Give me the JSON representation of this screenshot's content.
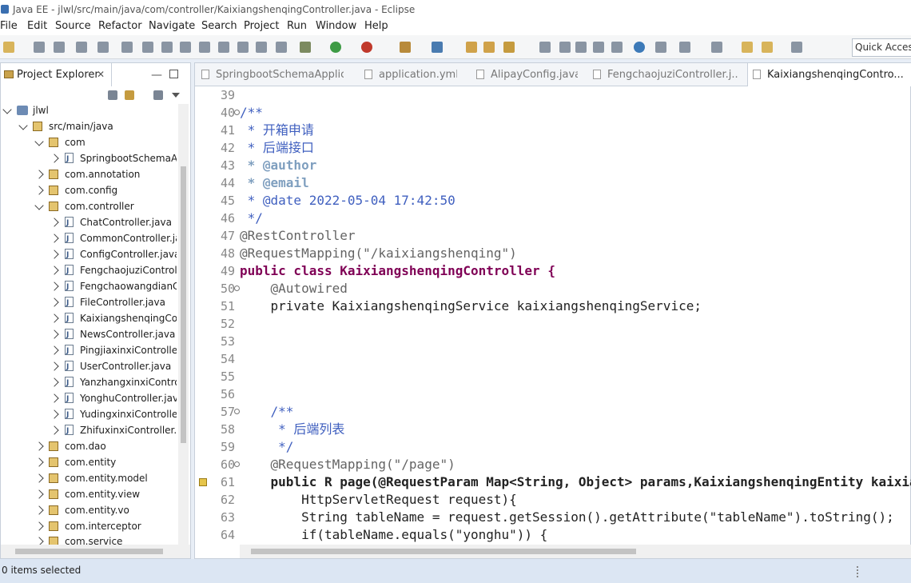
{
  "window": {
    "title": "Java EE - jlwl/src/main/java/com/controller/KaixiangshenqingController.java - Eclipse"
  },
  "menu": [
    "File",
    "Edit",
    "Source",
    "Refactor",
    "Navigate",
    "Search",
    "Project",
    "Run",
    "Window",
    "Help"
  ],
  "toolbar": {
    "quick_access": "Quick Access"
  },
  "explorer": {
    "tab_label": "Project Explorer",
    "tree": [
      "jlwl",
      "src/main/java",
      "com",
      "SpringbootSchemaApplication.java",
      "com.annotation",
      "com.config",
      "com.controller",
      "ChatController.java",
      "CommonController.java",
      "ConfigController.java",
      "FengchaojuziController.java",
      "FengchaowangdianController.java",
      "FileController.java",
      "KaixiangshenqingController.java",
      "NewsController.java",
      "PingjiaxinxiController.java",
      "UserController.java",
      "YanzhangxinxiController.java",
      "YonghuController.java",
      "YudingxinxiController.java",
      "ZhifuxinxiController.java",
      "com.dao",
      "com.entity",
      "com.entity.model",
      "com.entity.view",
      "com.entity.vo",
      "com.interceptor",
      "com.service"
    ]
  },
  "tabs": [
    "SpringbootSchemaApplic...",
    "application.yml",
    "AlipayConfig.java",
    "FengchaojuziController.j...",
    "KaixiangshenqingContro..."
  ],
  "editor": {
    "line_numbers": [
      "39",
      "40",
      "41",
      "42",
      "43",
      "44",
      "45",
      "46",
      "47",
      "48",
      "49",
      "50",
      "51",
      "52",
      "53",
      "54",
      "55",
      "56",
      "57",
      "58",
      "59",
      "60",
      "61",
      "62",
      "63",
      "64"
    ],
    "lines": [
      "",
      "/**",
      " * 开箱申请",
      " * 后端接口",
      " * @author",
      " * @email",
      " * @date 2022-05-04 17:42:50",
      " */",
      "@RestController",
      "@RequestMapping(\"/kaixiangshenqing\")",
      "public class KaixiangshenqingController {",
      "    @Autowired",
      "    private KaixiangshenqingService kaixiangshenqingService;",
      "",
      "",
      "",
      "",
      "",
      "    /**",
      "     * 后端列表",
      "     */",
      "    @RequestMapping(\"/page\")",
      "    public R page(@RequestParam Map<String, Object> params,KaixiangshenqingEntity kaixiangshenqing,",
      "        HttpServletRequest request){",
      "        String tableName = request.getSession().getAttribute(\"tableName\").toString();",
      "        if(tableName.equals(\"yonghu\")) {"
    ]
  },
  "status": {
    "text": "0 items selected"
  }
}
